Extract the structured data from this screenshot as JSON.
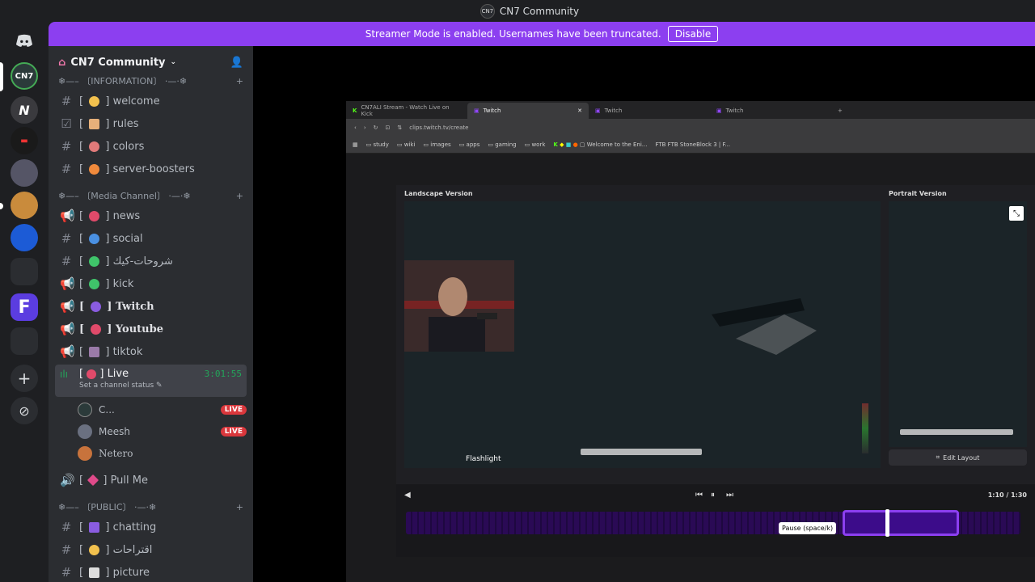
{
  "window": {
    "title": "CN7 Community"
  },
  "banner": {
    "text": "Streamer Mode is enabled. Usernames have been truncated.",
    "button": "Disable"
  },
  "guild": {
    "name": "CN7 Community"
  },
  "categories": {
    "information": "❄—– 〔INFORMATION〕 ·—·❄",
    "media": "❄—– 〔Media Channel〕 ·—·❄",
    "public": "❄—– 〔PUBLIC〕 ·—·❄"
  },
  "channels": [
    {
      "symbol": "#",
      "name": "welcome"
    },
    {
      "symbol": "☑",
      "name": "rules"
    },
    {
      "symbol": "#",
      "name": "colors"
    },
    {
      "symbol": "#",
      "name": "server-boosters"
    },
    {
      "symbol": "📢",
      "name": "news"
    },
    {
      "symbol": "#",
      "name": "social"
    },
    {
      "symbol": "#",
      "name": "شروحات-كيك"
    },
    {
      "symbol": "📢",
      "name": "kick"
    },
    {
      "symbol": "📢",
      "name": "Twitch"
    },
    {
      "symbol": "📢",
      "name": "Youtube"
    },
    {
      "symbol": "📢",
      "name": "tiktok"
    }
  ],
  "live_channel": {
    "name": "Live",
    "time": "3:01:55",
    "status": "Set a channel status ✎"
  },
  "voice_users": [
    {
      "name": "C...",
      "live": "LIVE"
    },
    {
      "name": "Meesh",
      "live": "LIVE"
    },
    {
      "name": "Netero",
      "live": ""
    }
  ],
  "pull_me": "Pull Me",
  "public_channels": [
    {
      "name": "chatting"
    },
    {
      "name": "اقتراحات"
    },
    {
      "name": "picture"
    }
  ],
  "browser": {
    "tabs": [
      "CN7ALI Stream - Watch Live on Kick",
      "Twitch",
      "Twitch",
      "Twitch"
    ],
    "url": "clips.twitch.tv/create",
    "bookmarks": [
      "study",
      "wiki",
      "images",
      "apps",
      "gaming",
      "work",
      "Welcome to the Eni...",
      "FTB StoneBlock 3 | F..."
    ]
  },
  "editor": {
    "landscape_label": "Landscape Version",
    "portrait_label": "Portrait Version",
    "overlay_text": "Flashlight",
    "edit_layout": "Edit Layout",
    "tooltip": "Pause (space/k)",
    "time": "1:10 / 1:30",
    "selection_start": 0.71,
    "selection_end": 0.9,
    "playhead": 0.78
  }
}
